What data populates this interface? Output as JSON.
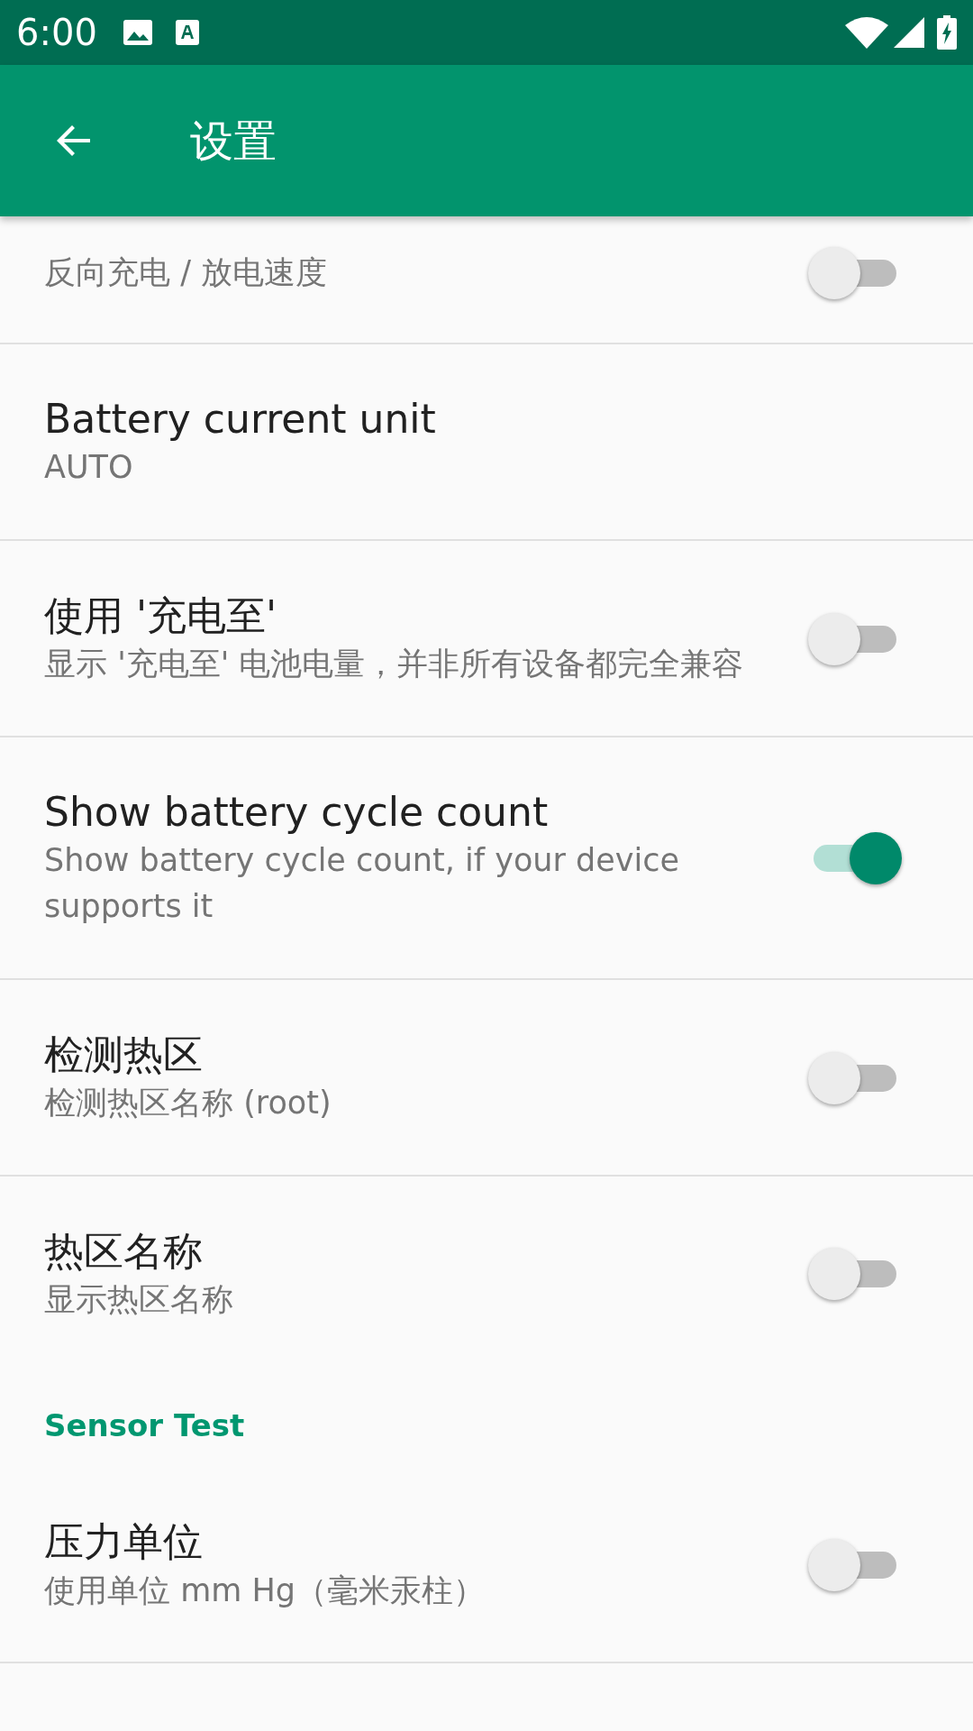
{
  "status_bar": {
    "time": "6:00"
  },
  "app_bar": {
    "title": "设置"
  },
  "items": [
    {
      "kind": "switch",
      "summary": "反向充电 / 放电速度",
      "on": false
    },
    {
      "kind": "text",
      "title": "Battery current unit",
      "summary": "AUTO"
    },
    {
      "kind": "switch",
      "title": "使用 '充电至'",
      "summary": "显示 '充电至' 电池电量，并非所有设备都完全兼容",
      "on": false
    },
    {
      "kind": "switch",
      "title": "Show battery cycle count",
      "summary": "Show battery cycle count, if your device supports it",
      "on": true
    },
    {
      "kind": "switch",
      "title": "检测热区",
      "summary": "检测热区名称 (root)",
      "on": false
    },
    {
      "kind": "switch",
      "title": "热区名称",
      "summary": "显示热区名称",
      "on": false
    },
    {
      "kind": "category",
      "title": "Sensor Test"
    },
    {
      "kind": "switch",
      "title": "压力单位",
      "summary": "使用单位 mm Hg（毫米汞柱）",
      "on": false
    }
  ]
}
